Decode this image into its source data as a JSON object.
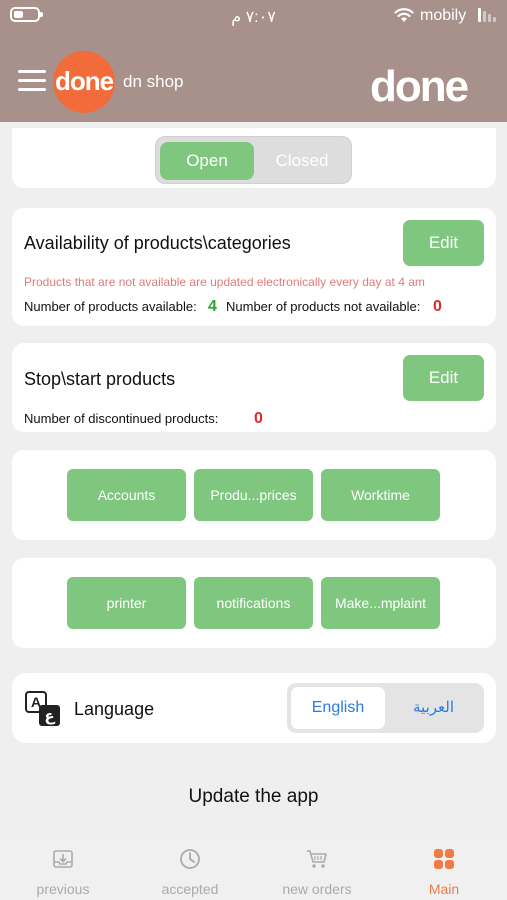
{
  "status_bar": {
    "time": "٧:٠٧ م",
    "carrier": "mobily"
  },
  "header": {
    "logo_text": "done",
    "shop_name": "dn shop",
    "brand_text": "done"
  },
  "store_toggle": {
    "open_label": "Open",
    "closed_label": "Closed",
    "selected": "Open"
  },
  "availability": {
    "title": "Availability of products\\categories",
    "edit_label": "Edit",
    "note": "Products that are not available are updated electronically every day at 4 am",
    "available_label": "Number of products available:",
    "available_count": "4",
    "unavailable_label": "Number of products not available:",
    "unavailable_count": "0"
  },
  "stop_start": {
    "title": "Stop\\start products",
    "edit_label": "Edit",
    "discontinued_label": "Number of discontinued products:",
    "discontinued_count": "0"
  },
  "actions_row1": [
    "Accounts",
    "Produ...prices",
    "Worktime"
  ],
  "actions_row2": [
    "printer",
    "notifications",
    "Make...mplaint"
  ],
  "language": {
    "label": "Language",
    "english": "English",
    "arabic": "العربية",
    "selected": "English"
  },
  "update_app_label": "Update the app",
  "tabs": [
    {
      "label": "previous",
      "icon": "inbox-icon"
    },
    {
      "label": "accepted",
      "icon": "clock-icon"
    },
    {
      "label": "new orders",
      "icon": "cart-icon"
    },
    {
      "label": "Main",
      "icon": "grid-icon",
      "active": true
    }
  ],
  "colors": {
    "header": "#a8918a",
    "accent_green": "#7fc77f",
    "active_tab": "#f07b47",
    "logo_orange": "#f26b3a"
  }
}
